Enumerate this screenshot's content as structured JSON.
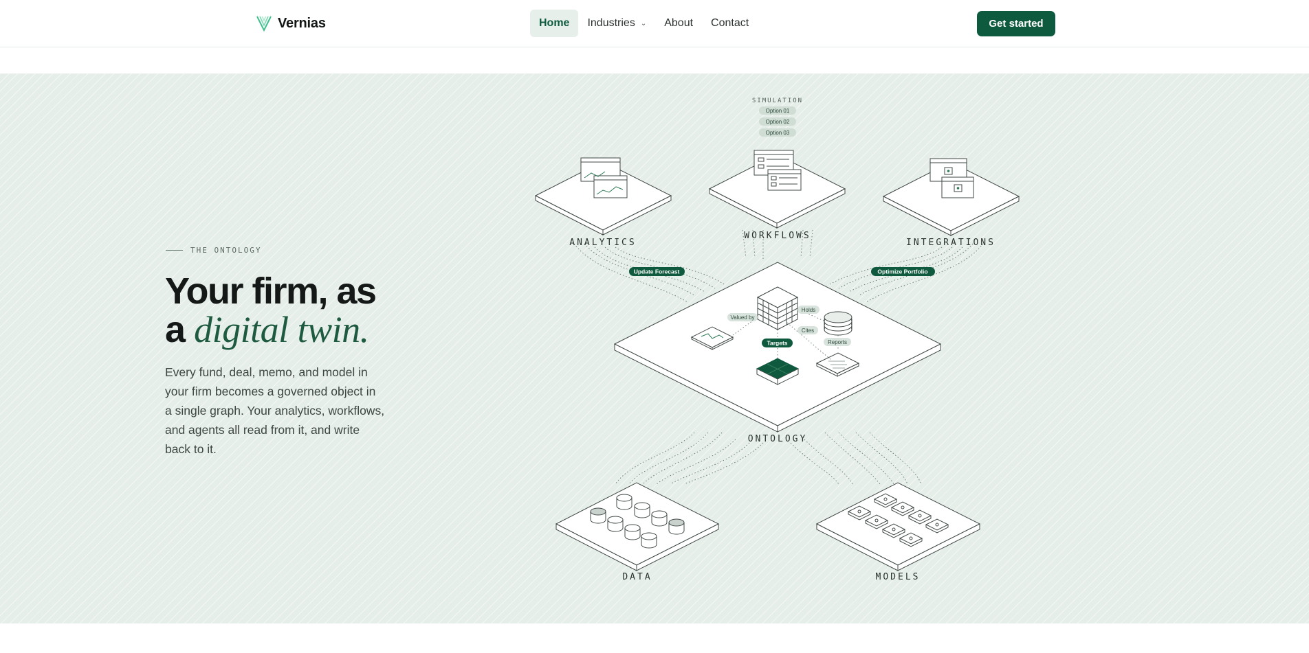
{
  "brand": {
    "name": "Vernias",
    "logo_icon": "v-logo-icon",
    "accent": "#0e5a3e"
  },
  "nav": {
    "links": [
      {
        "label": "Home",
        "active": true
      },
      {
        "label": "Industries",
        "has_dropdown": true
      },
      {
        "label": "About"
      },
      {
        "label": "Contact"
      }
    ],
    "cta_label": "Get started"
  },
  "hero": {
    "eyebrow": "THE ONTOLOGY",
    "headline_line1": "Your firm, as",
    "headline_line2_plain": "a",
    "headline_line2_accent": "digital twin.",
    "description": "Every fund, deal, memo, and model in your firm becomes a governed object in a single graph. Your analytics, workflows, and agents all read from it, and write back to it."
  },
  "diagram": {
    "platforms": {
      "analytics": "ANALYTICS",
      "workflows": "WORKFLOWS",
      "integrations": "INTEGRATIONS",
      "ontology": "ONTOLOGY",
      "data": "DATA",
      "models": "MODELS"
    },
    "simulation": {
      "title": "SIMULATION",
      "options": [
        "Option 01",
        "Option 02",
        "Option 03"
      ]
    },
    "action_pills": {
      "left": "Update Forecast",
      "right": "Optimize Portfolio"
    },
    "relations": {
      "valued_by": "Valued by",
      "holds": "Holds",
      "cites": "Cites",
      "reports": "Reports",
      "targets": "Targets"
    }
  }
}
